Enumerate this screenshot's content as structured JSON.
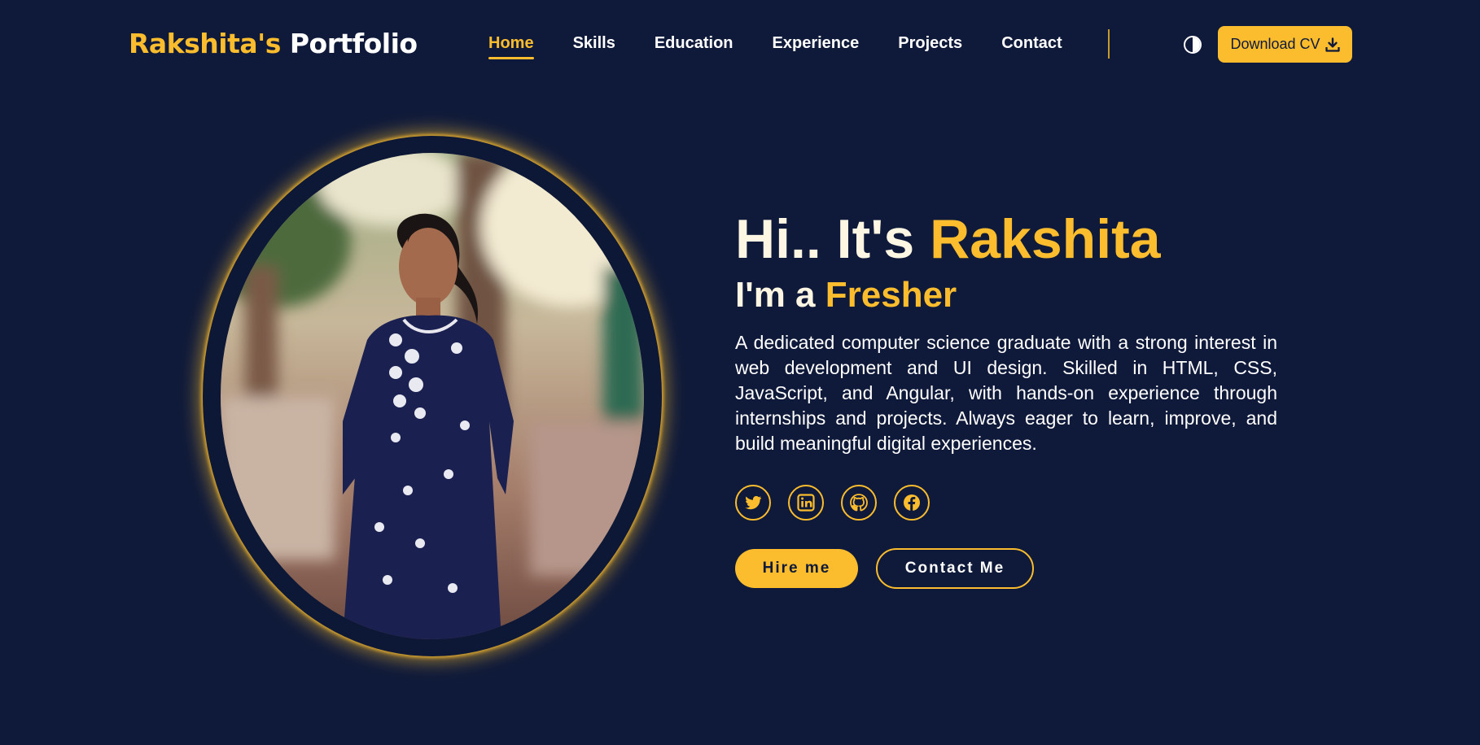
{
  "brand": {
    "name_part1": "Rakshita's",
    "name_part2": "Portfolio",
    "accent_color": "#fbbd2d",
    "background_color": "#0f1a3a"
  },
  "nav": {
    "items": [
      {
        "label": "Home",
        "active": true
      },
      {
        "label": "Skills",
        "active": false
      },
      {
        "label": "Education",
        "active": false
      },
      {
        "label": "Experience",
        "active": false
      },
      {
        "label": "Projects",
        "active": false
      },
      {
        "label": "Contact",
        "active": false
      }
    ],
    "theme_toggle_icon": "contrast-icon",
    "download_label": "Download CV",
    "download_icon": "download-icon"
  },
  "hero": {
    "greeting_prefix": "Hi.. It's",
    "greeting_name": "Rakshita",
    "role_prefix": "I'm a",
    "role_value": "Fresher",
    "bio": "A dedicated computer science graduate with a strong interest in web development and UI design. Skilled in HTML, CSS, JavaScript, and Angular, with hands-on experience through internships and projects. Always eager to learn, improve, and build meaningful digital experiences.",
    "socials": [
      {
        "icon": "twitter-icon"
      },
      {
        "icon": "linkedin-icon"
      },
      {
        "icon": "github-icon"
      },
      {
        "icon": "facebook-icon"
      }
    ],
    "hire_label": "Hire me",
    "contact_label": "Contact Me"
  }
}
